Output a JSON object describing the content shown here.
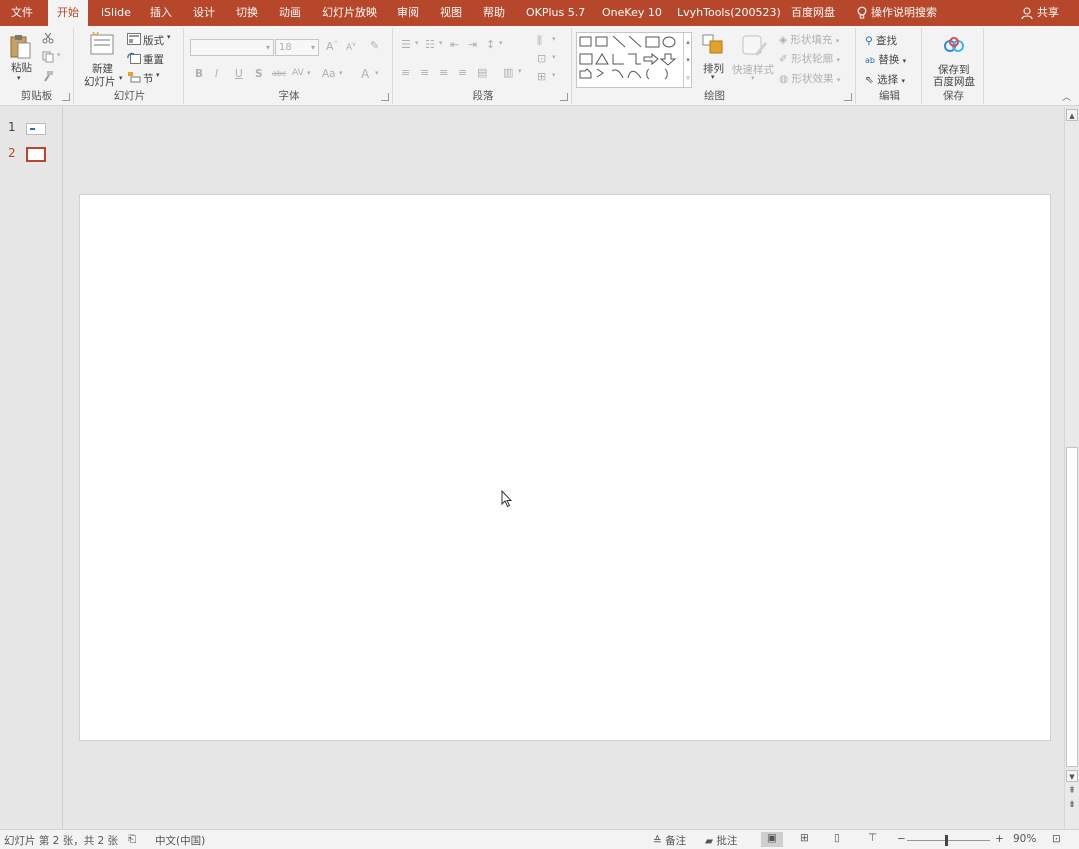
{
  "app": {
    "accent": "#b7472a"
  },
  "tabs": [
    {
      "label": "文件"
    },
    {
      "label": "开始"
    },
    {
      "label": "iSlide"
    },
    {
      "label": "插入"
    },
    {
      "label": "设计"
    },
    {
      "label": "切换"
    },
    {
      "label": "动画"
    },
    {
      "label": "幻灯片放映"
    },
    {
      "label": "审阅"
    },
    {
      "label": "视图"
    },
    {
      "label": "帮助"
    },
    {
      "label": "OKPlus 5.7"
    },
    {
      "label": "OneKey 10"
    },
    {
      "label": "LvyhTools(200523)"
    },
    {
      "label": "百度网盘"
    }
  ],
  "active_tab": "开始",
  "tell_me": "操作说明搜索",
  "share": "共享",
  "ribbon": {
    "clipboard": {
      "paste": "粘贴",
      "label": "剪贴板"
    },
    "slides": {
      "new_slide_line1": "新建",
      "new_slide_line2": "幻灯片",
      "layout": "版式",
      "reset": "重置",
      "section": "节",
      "label": "幻灯片"
    },
    "font": {
      "size": "18",
      "change_case": "Aa",
      "label": "字体"
    },
    "paragraph": {
      "label": "段落"
    },
    "drawing": {
      "arrange": "排列",
      "quick_styles": "快速样式",
      "shape_fill": "形状填充",
      "shape_outline": "形状轮廓",
      "shape_effects": "形状效果",
      "label": "绘图"
    },
    "editing": {
      "find": "查找",
      "replace": "替换",
      "select": "选择",
      "label": "编辑"
    },
    "save": {
      "line1": "保存到",
      "line2": "百度网盘",
      "label": "保存"
    }
  },
  "thumbnails": [
    {
      "number": "1"
    },
    {
      "number": "2"
    }
  ],
  "selected_slide": 2,
  "status": {
    "slide_info": "幻灯片 第 2 张，共 2 张",
    "language": "中文(中国)",
    "notes": "备注",
    "comments": "批注",
    "zoom": "90%",
    "zoom_minus": "−",
    "zoom_plus": "+"
  }
}
